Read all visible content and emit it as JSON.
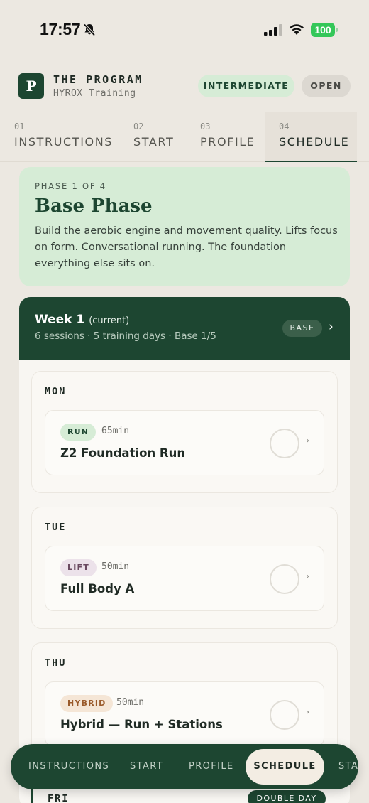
{
  "status": {
    "time": "17:57",
    "battery": "100"
  },
  "header": {
    "logo_letter": "P",
    "title": "THE PROGRAM",
    "subtitle": "HYROX Training",
    "level": "INTERMEDIATE",
    "open": "OPEN"
  },
  "tabs": [
    {
      "num": "01",
      "label": "INSTRUCTIONS"
    },
    {
      "num": "02",
      "label": "START"
    },
    {
      "num": "03",
      "label": "PROFILE"
    },
    {
      "num": "04",
      "label": "SCHEDULE"
    }
  ],
  "phase": {
    "kicker": "PHASE 1 OF 4",
    "title": "Base Phase",
    "description": "Build the aerobic engine and movement quality. Lifts focus on form. Conversational running. The foundation everything else sits on."
  },
  "week": {
    "title": "Week 1",
    "current": "(current)",
    "summary": "6 sessions · 5 training days · Base 1/5",
    "badge": "BASE",
    "chevron": "›"
  },
  "days": [
    {
      "label": "MON",
      "session": {
        "tag": "RUN",
        "duration": "65min",
        "name": "Z2 Foundation Run"
      }
    },
    {
      "label": "TUE",
      "session": {
        "tag": "LIFT",
        "duration": "50min",
        "name": "Full Body A"
      }
    },
    {
      "label": "THU",
      "session": {
        "tag": "HYBRID",
        "duration": "50min",
        "name": "Hybrid — Run + Stations"
      }
    }
  ],
  "fri": {
    "label": "FRI",
    "badge": "DOUBLE DAY"
  },
  "session_chevron": "›",
  "bottom_nav": [
    "INSTRUCTIONS",
    "START",
    "PROFILE",
    "SCHEDULE",
    "STA"
  ],
  "colors": {
    "accent": "#1d4631",
    "accent_light": "#d6ecd6",
    "background": "#ece8e1"
  }
}
